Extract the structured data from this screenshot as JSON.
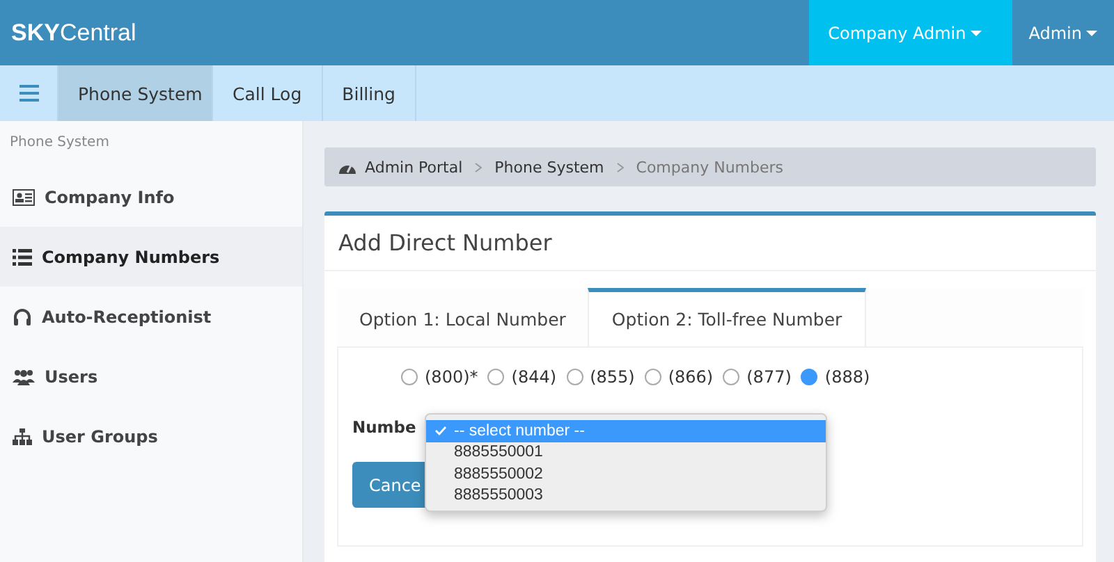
{
  "header": {
    "logo_bold": "SKY",
    "logo_rest": "Central",
    "menus": [
      {
        "label": "Company Admin",
        "selected": true
      },
      {
        "label": "Admin",
        "selected": false
      }
    ]
  },
  "nav": {
    "tabs": [
      {
        "label": "Phone System",
        "selected": true
      },
      {
        "label": "Call Log",
        "selected": false
      },
      {
        "label": "Billing",
        "selected": false
      }
    ]
  },
  "sidebar": {
    "heading": "Phone System",
    "items": [
      {
        "label": "Company Info",
        "kind": "card",
        "selected": false
      },
      {
        "label": "Company Numbers",
        "kind": "list",
        "selected": true
      },
      {
        "label": "Auto-Receptionist",
        "kind": "headset",
        "selected": false
      },
      {
        "label": "Users",
        "kind": "group",
        "selected": false
      },
      {
        "label": "User Groups",
        "kind": "tree",
        "selected": false
      }
    ]
  },
  "breadcrumb": [
    "Admin Portal",
    "Phone System",
    "Company Numbers"
  ],
  "panel": {
    "title": "Add Direct Number",
    "tabs": [
      {
        "label": "Option 1: Local Number",
        "selected": false
      },
      {
        "label": "Option 2: Toll-free Number",
        "selected": true
      }
    ],
    "prefixes": [
      {
        "label": "(800)*",
        "selected": false
      },
      {
        "label": "(844)",
        "selected": false
      },
      {
        "label": "(855)",
        "selected": false
      },
      {
        "label": "(866)",
        "selected": false
      },
      {
        "label": "(877)",
        "selected": false
      },
      {
        "label": "(888)",
        "selected": true
      }
    ],
    "number_label": "Numbe",
    "dropdown": [
      {
        "label": "-- select number --",
        "selected": true
      },
      {
        "label": "8885550001",
        "selected": false
      },
      {
        "label": "8885550002",
        "selected": false
      },
      {
        "label": "8885550003",
        "selected": false
      }
    ],
    "cancel_button": "Cance"
  }
}
